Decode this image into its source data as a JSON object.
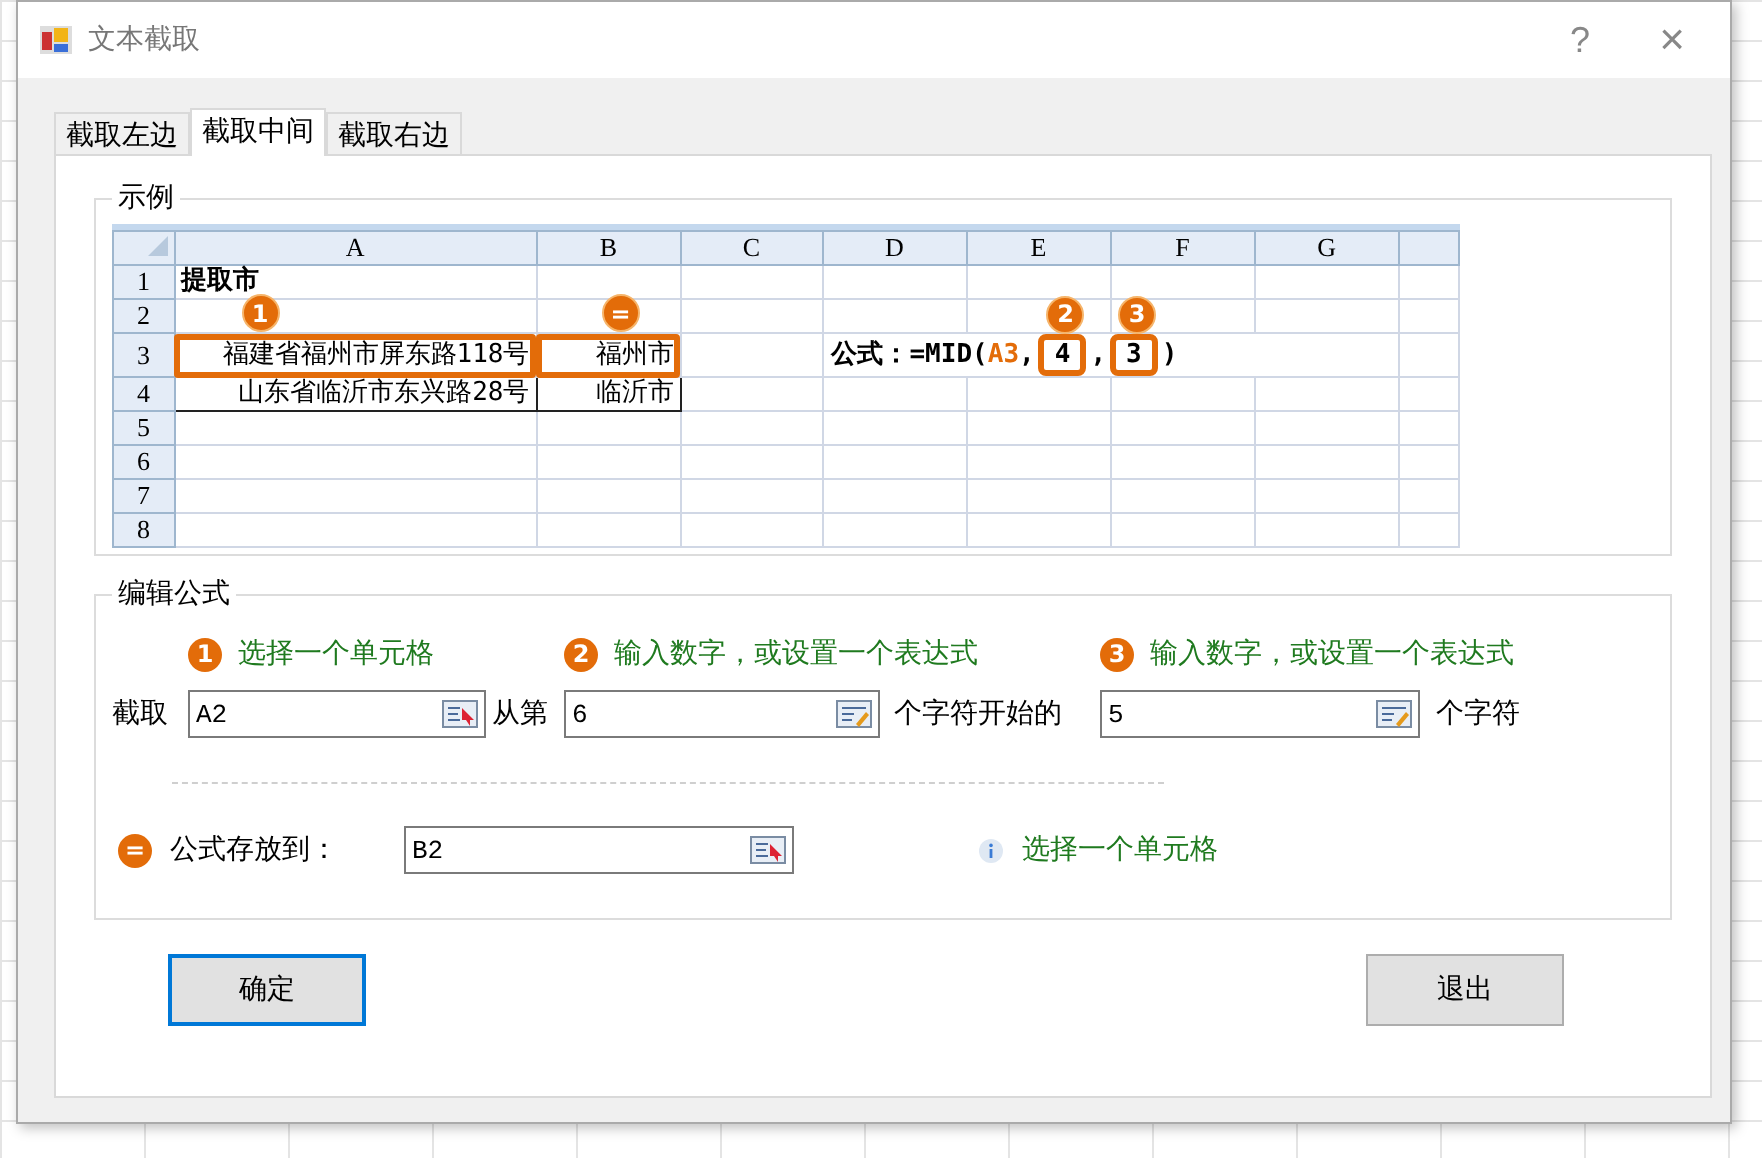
{
  "window": {
    "title": "文本截取",
    "help": "?",
    "close": "×"
  },
  "tabs": [
    {
      "label": "截取左边",
      "selected": false
    },
    {
      "label": "截取中间",
      "selected": true
    },
    {
      "label": "截取右边",
      "selected": false
    }
  ],
  "example": {
    "title": "示例",
    "sheet": {
      "columns": [
        "A",
        "B",
        "C",
        "D",
        "E",
        "F",
        "G"
      ],
      "row_numbers": [
        "1",
        "2",
        "3",
        "4",
        "5",
        "6",
        "7",
        "8"
      ],
      "title_cell": "提取市",
      "rows": [
        {
          "source": "福建省福州市屏东路118号",
          "result": "福州市",
          "highlighted": true
        },
        {
          "source": "山东省临沂市东兴路28号",
          "result": "临沂市",
          "highlighted": false
        }
      ],
      "source_badge": "1",
      "result_badge": "=",
      "formula": {
        "prefix": "公式：=MID(",
        "ref": "A3",
        "sep": ",",
        "arg1": "4",
        "arg1_badge": "2",
        "sep2": ",",
        "arg2": "3",
        "arg2_badge": "3",
        "close": ")"
      }
    }
  },
  "edit": {
    "title": "编辑公式",
    "steps": [
      {
        "badge": "1",
        "hint": "选择一个单元格"
      },
      {
        "badge": "2",
        "hint": "输入数字，或设置一个表达式"
      },
      {
        "badge": "3",
        "hint": "输入数字，或设置一个表达式"
      }
    ],
    "label_take": "截取",
    "fields": [
      {
        "value": "A2",
        "kind": "cell"
      },
      {
        "value": "6",
        "kind": "expression"
      },
      {
        "value": "5",
        "kind": "expression"
      }
    ],
    "label_from": "从第",
    "label_start": "个字符开始的",
    "label_chars": "个字符",
    "output": {
      "badge": "=",
      "label": "公式存放到：",
      "value": "B2",
      "info": "选择一个单元格"
    }
  },
  "buttons": [
    {
      "label": "确定",
      "focused": true
    },
    {
      "label": "退出",
      "focused": false
    }
  ]
}
